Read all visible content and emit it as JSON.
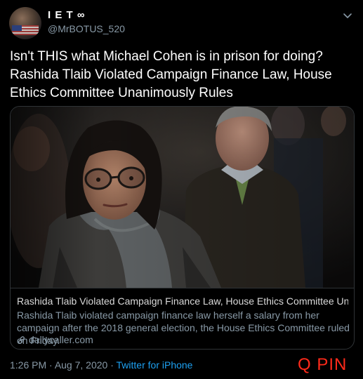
{
  "account": {
    "display_name": "I E T ∞",
    "handle": "@MrBOTUS_520"
  },
  "tweet": {
    "text": "Isn't THIS what Michael Cohen is in prison for doing?\nRashida Tlaib Violated Campaign Finance Law, House Ethics Committee Unanimously Rules"
  },
  "link_card": {
    "title": "Rashida Tlaib Violated Campaign Finance Law, House Ethics Committee Unani...",
    "description": "Rashida Tlaib violated campaign finance law herself a salary from her campaign after the 2018 general election, the House Ethics Committee ruled on Friday.",
    "domain": "dailycaller.com"
  },
  "meta": {
    "time": "1:26 PM",
    "separator": " · ",
    "date": "Aug 7, 2020",
    "source": "Twitter for iPhone"
  },
  "watermark": "Q PIN",
  "icons": [
    "chevron-down-icon",
    "link-icon"
  ],
  "colors": {
    "background": "#000000",
    "secondary_text": "#8899a6",
    "link_blue": "#1da1f2",
    "watermark_red": "#ff2a1a"
  }
}
